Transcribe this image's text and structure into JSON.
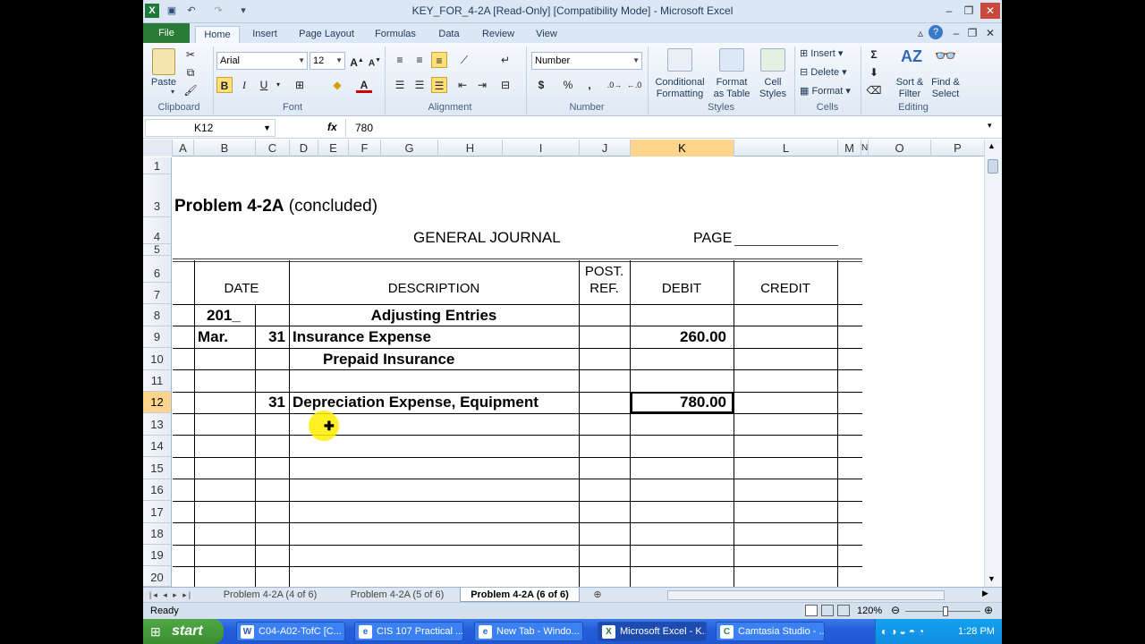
{
  "window": {
    "title": "KEY_FOR_4-2A  [Read-Only]  [Compatibility Mode]  -  Microsoft Excel"
  },
  "ribbon_tabs": [
    "File",
    "Home",
    "Insert",
    "Page Layout",
    "Formulas",
    "Data",
    "Review",
    "View"
  ],
  "ribbon": {
    "clipboard": {
      "paste": "Paste",
      "group": "Clipboard"
    },
    "font": {
      "name": "Arial",
      "size": "12",
      "bold": "B",
      "italic": "I",
      "underline": "U",
      "group": "Font"
    },
    "alignment": {
      "group": "Alignment"
    },
    "number": {
      "format": "Number",
      "currency": "$",
      "percent": "%",
      "comma": ",",
      "group": "Number"
    },
    "styles": {
      "conditional": [
        "Conditional",
        "Formatting"
      ],
      "format_table": [
        "Format",
        "as Table"
      ],
      "cell_styles": [
        "Cell",
        "Styles"
      ],
      "group": "Styles"
    },
    "cells": {
      "insert": "Insert",
      "delete": "Delete",
      "format": "Format",
      "group": "Cells"
    },
    "editing": {
      "sum": "Σ",
      "sort": [
        "Sort &",
        "Filter"
      ],
      "find": [
        "Find &",
        "Select"
      ],
      "group": "Editing"
    }
  },
  "formula_bar": {
    "name_box": "K12",
    "fx": "fx",
    "value": "780"
  },
  "columns": [
    "A",
    "B",
    "C",
    "D",
    "E",
    "F",
    "G",
    "H",
    "I",
    "J",
    "K",
    "L",
    "M",
    "N",
    "O",
    "P"
  ],
  "rows": [
    "1",
    "3",
    "4",
    "5",
    "6",
    "7",
    "8",
    "9",
    "10",
    "11",
    "12",
    "13",
    "14",
    "15",
    "16",
    "17",
    "18",
    "19",
    "20"
  ],
  "sheet": {
    "title_bold": "Problem 4-2A",
    "title_rest": " (concluded)",
    "journal_title": "GENERAL JOURNAL",
    "page_label": "PAGE",
    "headers": {
      "date": "DATE",
      "description": "DESCRIPTION",
      "post": "POST.",
      "ref": "REF.",
      "debit": "DEBIT",
      "credit": "CREDIT"
    },
    "entries": {
      "year": "201_",
      "heading": "Adjusting Entries",
      "month": "Mar.",
      "day1": "31",
      "acct1": "Insurance Expense",
      "debit1": "260.00",
      "acct2": "Prepaid Insurance",
      "day2": "31",
      "acct3": "Depreciation Expense, Equipment",
      "debit3": "780.00"
    }
  },
  "sheet_tabs": [
    "Problem 4-2A (4 of 6)",
    "Problem 4-2A (5 of 6)",
    "Problem 4-2A (6 of 6)"
  ],
  "status": {
    "ready": "Ready",
    "zoom": "120%"
  },
  "taskbar": {
    "start": "start",
    "items": [
      "C04-A02-TofC [C...",
      "CIS 107 Practical ...",
      "New Tab - Windo...",
      "Microsoft Excel - K...",
      "Camtasia Studio - ..."
    ],
    "clock": "1:28 PM"
  }
}
